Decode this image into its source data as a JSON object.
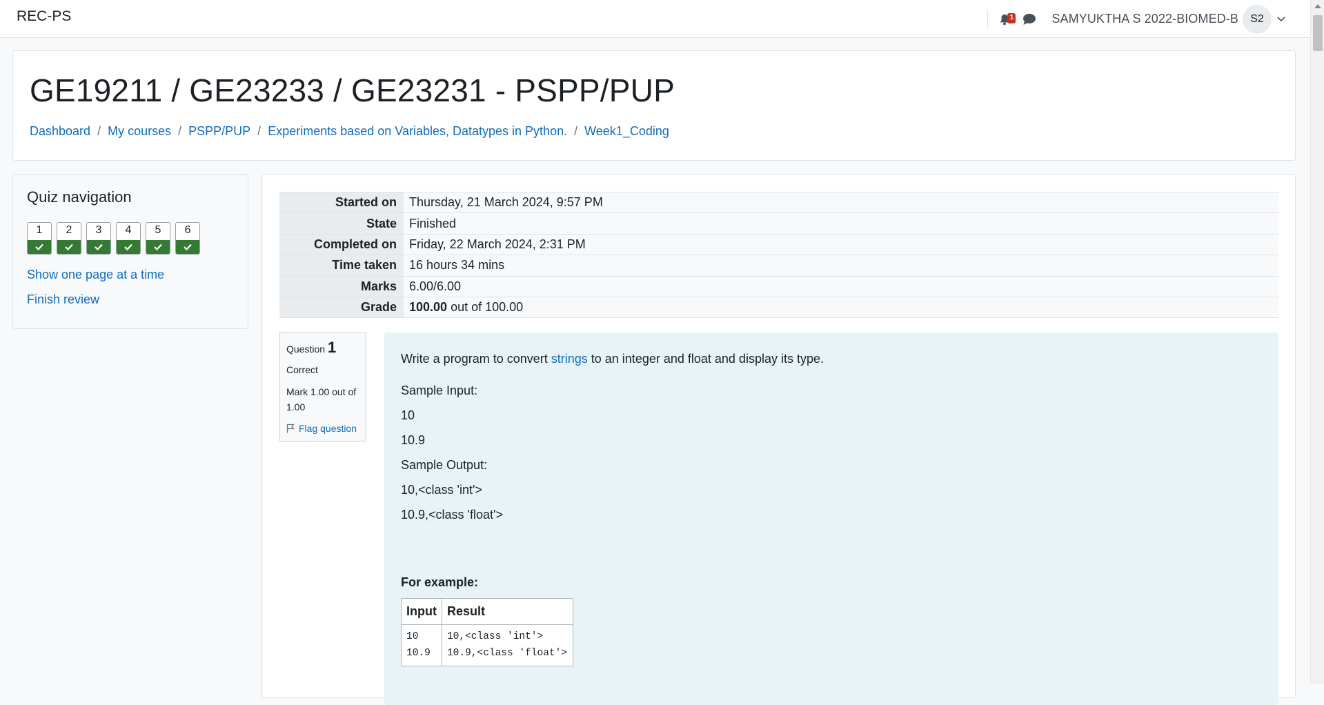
{
  "navbar": {
    "brand": "REC-PS",
    "notification_count": "1",
    "user_name": "SAMYUKTHA S 2022-BIOMED-B",
    "avatar_initials": "S2"
  },
  "header": {
    "title": "GE19211 / GE23233 / GE23231 - PSPP/PUP",
    "breadcrumbs": [
      "Dashboard",
      "My courses",
      "PSPP/PUP",
      "Experiments based on Variables, Datatypes in Python.",
      "Week1_Coding"
    ],
    "separator": "/"
  },
  "quiz_nav": {
    "title": "Quiz navigation",
    "questions": [
      "1",
      "2",
      "3",
      "4",
      "5",
      "6"
    ],
    "status": "correct",
    "show_one_page": "Show one page at a time",
    "finish_review": "Finish review"
  },
  "summary": {
    "started_on": {
      "label": "Started on",
      "value": "Thursday, 21 March 2024, 9:57 PM"
    },
    "state": {
      "label": "State",
      "value": "Finished"
    },
    "completed_on": {
      "label": "Completed on",
      "value": "Friday, 22 March 2024, 2:31 PM"
    },
    "time_taken": {
      "label": "Time taken",
      "value": "16 hours 34 mins"
    },
    "marks": {
      "label": "Marks",
      "value": "6.00/6.00"
    },
    "grade": {
      "label": "Grade",
      "value_bold": "100.00",
      "value_rest": " out of 100.00"
    }
  },
  "question": {
    "label": "Question",
    "number": "1",
    "state": "Correct",
    "mark": "Mark 1.00 out of 1.00",
    "flag": "Flag question",
    "text_before": "Write a program to convert ",
    "text_link": "strings",
    "text_after": " to an integer and float and display its type.",
    "sample_input_label": "Sample Input:",
    "sample_input_1": "10",
    "sample_input_2": "10.9",
    "sample_output_label": "Sample Output:",
    "sample_output_1": "10,<class 'int'>",
    "sample_output_2": "10.9,<class 'float'>",
    "for_example": "For example:",
    "example_headers": [
      "Input",
      "Result"
    ],
    "example_input": "10\n10.9",
    "example_result": "10,<class 'int'>\n10.9,<class 'float'>"
  },
  "colors": {
    "link": "#0f6cbf",
    "correct_green": "#357a32",
    "badge_red": "#ca3120",
    "question_bg": "#e7f3f5"
  }
}
